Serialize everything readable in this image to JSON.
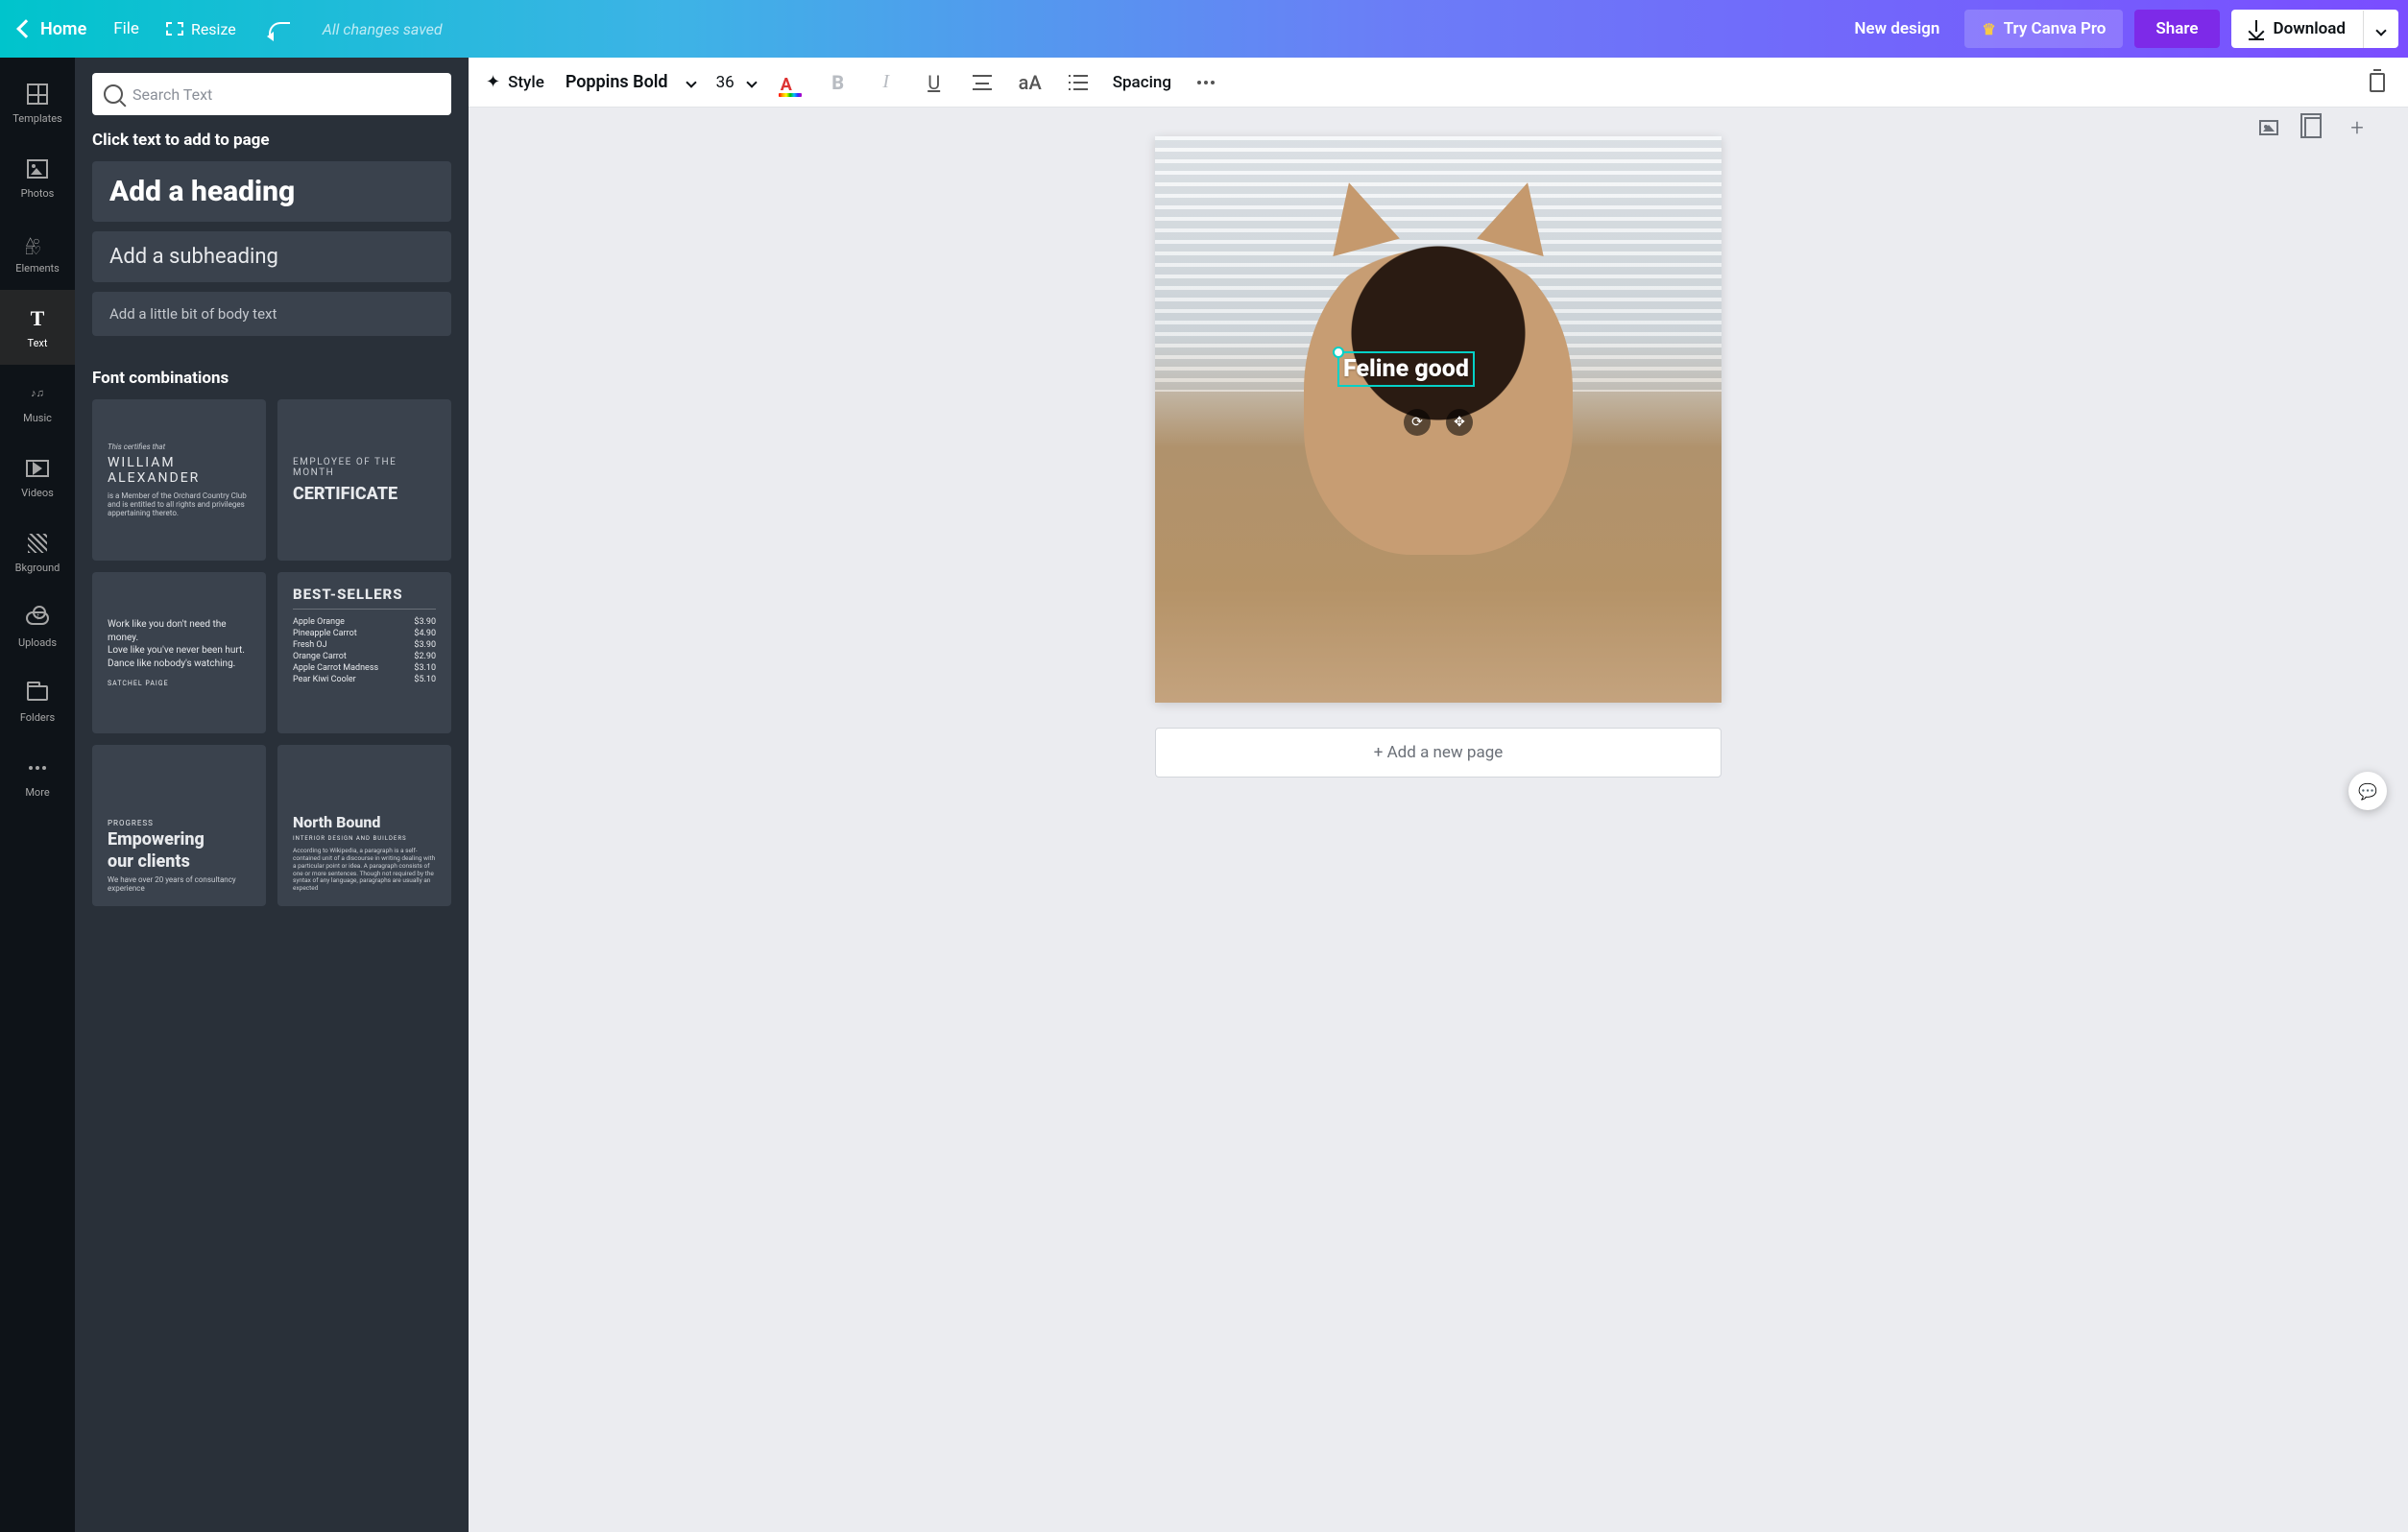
{
  "header": {
    "home": "Home",
    "file": "File",
    "resize": "Resize",
    "saved": "All changes saved",
    "new_design": "New design",
    "try_pro": "Try Canva Pro",
    "share": "Share",
    "download": "Download"
  },
  "rail": {
    "templates": "Templates",
    "photos": "Photos",
    "elements": "Elements",
    "text": "Text",
    "music": "Music",
    "videos": "Videos",
    "bkground": "Bkground",
    "uploads": "Uploads",
    "folders": "Folders",
    "more": "More"
  },
  "panel": {
    "search_placeholder": "Search Text",
    "hint": "Click text to add to page",
    "add_heading": "Add a heading",
    "add_subheading": "Add a subheading",
    "add_body": "Add a little bit of body text",
    "font_combos": "Font combinations",
    "cards": {
      "c1": {
        "tiny": "This certifies that",
        "name": "WILLIAM ALEXANDER",
        "desc": "is a Member of the Orchard Country Club and is entitled to all rights and privileges appertaining thereto."
      },
      "c2": {
        "sup": "EMPLOYEE OF THE MONTH",
        "title": "CERTIFICATE"
      },
      "c3": {
        "l1": "Work like you don't need the money.",
        "l2": "Love like you've never been hurt.",
        "l3": "Dance like nobody's watching.",
        "attr": "SATCHEL PAIGE"
      },
      "c4": {
        "title": "BEST-SELLERS",
        "items": [
          {
            "name": "Apple Orange",
            "price": "$3.90"
          },
          {
            "name": "Pineapple Carrot",
            "price": "$4.90"
          },
          {
            "name": "Fresh OJ",
            "price": "$3.90"
          },
          {
            "name": "Orange Carrot",
            "price": "$2.90"
          },
          {
            "name": "Apple Carrot Madness",
            "price": "$3.10"
          },
          {
            "name": "Pear Kiwi Cooler",
            "price": "$5.10"
          }
        ]
      },
      "c5": {
        "prog": "PROGRESS",
        "l1": "Empowering",
        "l2": "our clients",
        "sub": "We have over 20 years of consultancy experience"
      },
      "c6": {
        "title": "North Bound",
        "sub": "INTERIOR DESIGN AND BUILDERS",
        "lorem": "According to Wikipedia, a paragraph is a self-contained unit of a discourse in writing dealing with a particular point or idea. A paragraph consists of one or more sentences. Though not required by the syntax of any language, paragraphs are usually an expected"
      }
    }
  },
  "toolbar": {
    "style": "Style",
    "font": "Poppins Bold",
    "size": "36",
    "spacing": "Spacing",
    "case": "aA"
  },
  "canvas": {
    "text": "Feline good",
    "add_page": "+ Add a new page"
  }
}
